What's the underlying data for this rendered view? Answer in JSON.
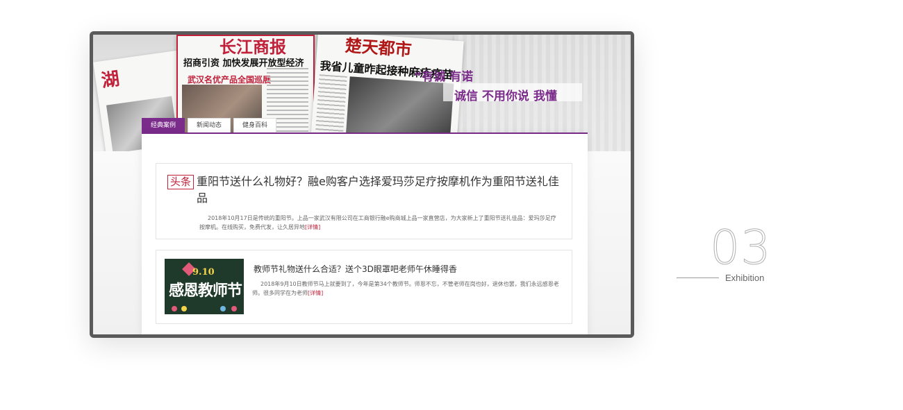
{
  "banner": {
    "paper1_masthead": "湖",
    "paper2_masthead": "长江商报",
    "paper2_headline": "招商引资 加快发展开放型经济",
    "paper2_sub": "武汉名优产品全国巡展",
    "paper3_masthead": "楚天都市",
    "paper3_headline": "我省儿童昨起接种麻疹疫苗",
    "slogan_line1": "“有诚 有诺",
    "slogan_line2": "诚信 不用你说 我懂"
  },
  "tabs": [
    {
      "label": "经典案例",
      "active": true
    },
    {
      "label": "新闻动态",
      "active": false
    },
    {
      "label": "健身百科",
      "active": false
    }
  ],
  "articles": [
    {
      "badge": "头条",
      "title": "重阳节送什么礼物好？融e购客户选择爱玛莎足疗按摩机作为重阳节送礼佳品",
      "desc": "2018年10月17日是传统的重阳节。上品一家武汉有限公司在工商银行融e购商城上品一家直营店，为大家新上了重阳节送礼佳品：爱玛莎足疗按摩机。在线购买，免费代发，让久居异地",
      "more": "[详情]"
    },
    {
      "thumb_date": "9.10",
      "thumb_text": "感恩教师节",
      "title": "教师节礼物送什么合适？送个3D眼罩吧老师午休睡得香",
      "desc": "2018年9月10日教师节马上就要到了，今年是第34个教师节。师恩不忘，不管老师在岗也好，退休也罢，我们永远感恩老师。很多同学在为老师",
      "more": "[详情]"
    }
  ],
  "section": {
    "number": "03",
    "label": "Exhibition"
  }
}
